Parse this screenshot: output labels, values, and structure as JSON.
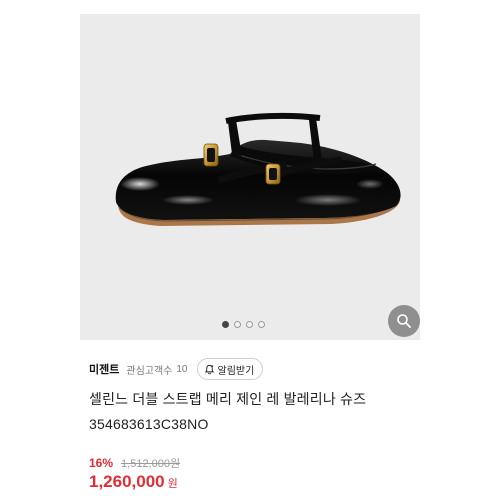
{
  "gallery": {
    "image_icon": "black-patent-double-strap-mary-jane-ballerina-shoe",
    "zoom_icon": "magnifier-icon",
    "dot_count": 4,
    "active_dot": 1
  },
  "brand": {
    "name": "미젠트",
    "followers_label": "관심고객수",
    "followers_count": "10",
    "notify_label": "알림받기"
  },
  "product": {
    "title": "셀린느 더블 스트랩 메리 제인 레 발레리나 슈즈",
    "code": "354683613C38NO"
  },
  "price": {
    "discount": "16%",
    "original": "1,512,000원",
    "sale": "1,260,000",
    "currency": "원"
  },
  "colors": {
    "accent": "#e02d36",
    "image_background": "#ebebeb"
  }
}
